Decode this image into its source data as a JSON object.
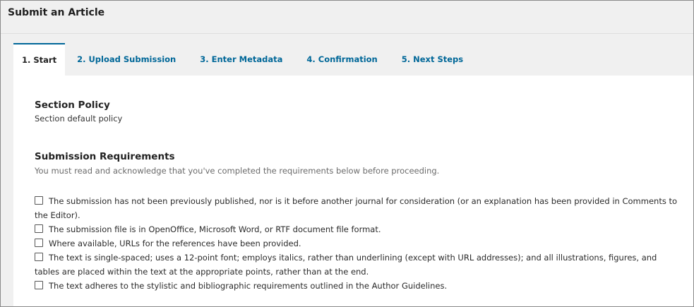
{
  "page": {
    "title": "Submit an Article"
  },
  "tabs": [
    {
      "label": "1. Start",
      "active": true
    },
    {
      "label": "2. Upload Submission",
      "active": false
    },
    {
      "label": "3. Enter Metadata",
      "active": false
    },
    {
      "label": "4. Confirmation",
      "active": false
    },
    {
      "label": "5. Next Steps",
      "active": false
    }
  ],
  "section_policy": {
    "heading": "Section Policy",
    "text": "Section default policy"
  },
  "requirements": {
    "heading": "Submission Requirements",
    "intro": "You must read and acknowledge that you've completed the requirements below before proceeding.",
    "items": [
      {
        "text": "The submission has not been previously published, nor is it before another journal for consideration (or an explanation has been provided in Comments to the Editor).",
        "checked": false
      },
      {
        "text": "The submission file is in OpenOffice, Microsoft Word, or RTF document file format.",
        "checked": false
      },
      {
        "text": "Where available, URLs for the references have been provided.",
        "checked": false
      },
      {
        "text": "The text is single-spaced; uses a 12-point font; employs italics, rather than underlining (except with URL addresses); and all illustrations, figures, and tables are placed within the text at the appropriate points, rather than at the end.",
        "checked": false
      },
      {
        "text": "The text adheres to the stylistic and bibliographic requirements outlined in the Author Guidelines.",
        "checked": false
      }
    ]
  },
  "colors": {
    "accent": "#006798",
    "background": "#f0f0f0",
    "panel": "#ffffff"
  }
}
